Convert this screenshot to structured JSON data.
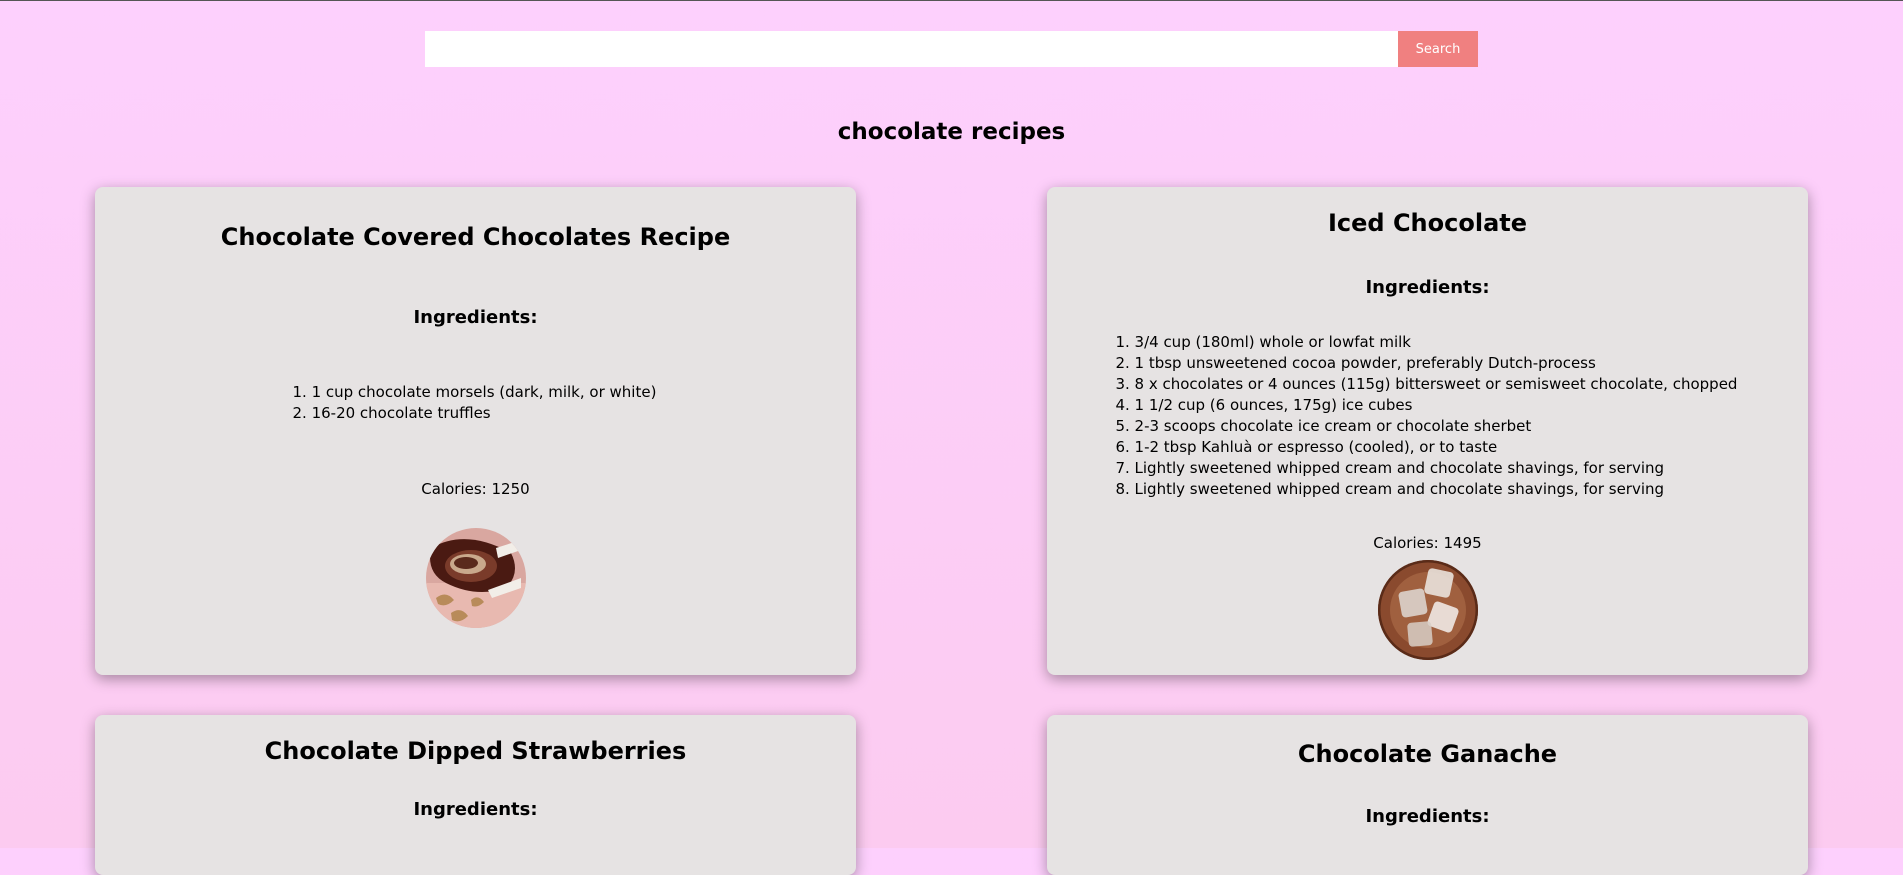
{
  "search": {
    "value": "",
    "placeholder": "",
    "button_label": "Search"
  },
  "page_title": "chocolate recipes",
  "recipes": [
    {
      "title": "Chocolate Covered Chocolates Recipe",
      "ingredients_heading": "Ingredients:",
      "ingredients": [
        "1 cup chocolate morsels (dark, milk, or white)",
        "16-20 chocolate truffles"
      ],
      "calories": "Calories: 1250",
      "image": "chocolate-truffles-photo"
    },
    {
      "title": "Iced Chocolate",
      "ingredients_heading": "Ingredients:",
      "ingredients": [
        "3/4 cup (180ml) whole or lowfat milk",
        "1 tbsp unsweetened cocoa powder, preferably Dutch-process",
        "8 x chocolates or 4 ounces (115g) bittersweet or semisweet chocolate, chopped",
        "1 1/2 cup (6 ounces, 175g) ice cubes",
        "2-3 scoops chocolate ice cream or chocolate sherbet",
        "1-2 tbsp Kahluà or espresso (cooled), or to taste",
        "Lightly sweetened whipped cream and chocolate shavings, for serving",
        "Lightly sweetened whipped cream and chocolate shavings, for serving"
      ],
      "calories": "Calories: 1495",
      "image": "iced-chocolate-photo"
    },
    {
      "title": "Chocolate Dipped Strawberries",
      "ingredients_heading": "Ingredients:"
    },
    {
      "title": "Chocolate Ganache",
      "ingredients_heading": "Ingredients:"
    }
  ],
  "colors": {
    "background_top": "#fdd0fd",
    "card": "#e6e3e3",
    "search_button": "#f08080"
  }
}
